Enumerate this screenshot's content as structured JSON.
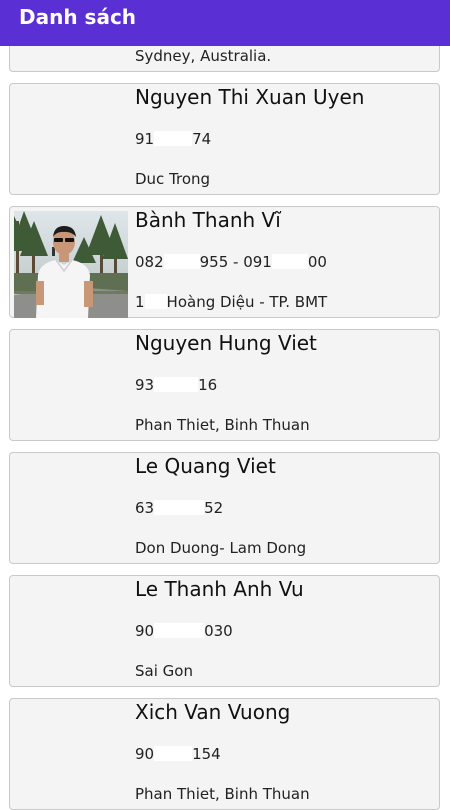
{
  "app_bar": {
    "title": "Danh sách",
    "color": "#5a2fd3"
  },
  "contacts": [
    {
      "name": "",
      "phone": "",
      "address": "Sydney, Australia."
    },
    {
      "name": "Nguyen Thi Xuan Uyen",
      "phone_start": "91",
      "phone_end": "74",
      "address": "Duc Trong"
    },
    {
      "name": "Bành Thanh Vĩ",
      "phone_start": "082",
      "phone_mid": "955 - 091",
      "phone_end": "00",
      "address_start": "1",
      "address_end": "Hoàng Diệu - TP. BMT",
      "has_photo": true
    },
    {
      "name": "Nguyen Hung Viet",
      "phone_start": "93",
      "phone_end": "16",
      "address": "Phan Thiet, Binh Thuan"
    },
    {
      "name": "Le Quang Viet",
      "phone_start": "63",
      "phone_end": "52",
      "address": "Don Duong- Lam Dong"
    },
    {
      "name": "Le Thanh Anh Vu",
      "phone_start": "90",
      "phone_end": "030",
      "address": "Sai Gon"
    },
    {
      "name": "Xich Van Vuong",
      "phone_start": "90",
      "phone_end": "154",
      "address": "Phan Thiet, Binh Thuan"
    }
  ]
}
